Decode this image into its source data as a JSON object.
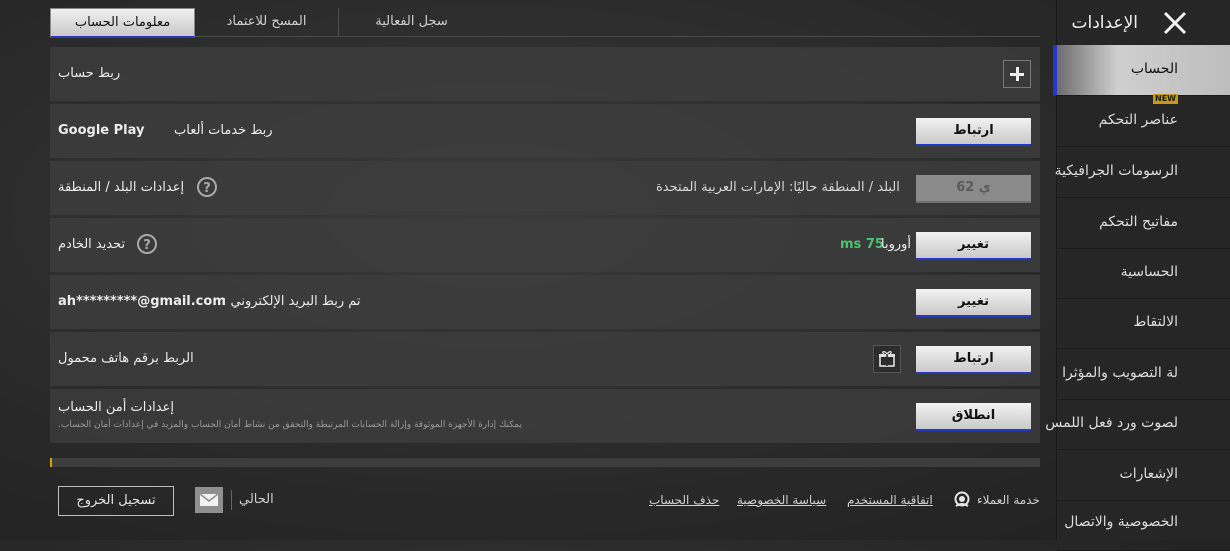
{
  "sidebar": {
    "title": "الإعدادات",
    "items": [
      {
        "label": "الحساب",
        "active": true
      },
      {
        "label": "عناصر التحكم",
        "badge": "NEW"
      },
      {
        "label": "الرسومات الجرافيكية"
      },
      {
        "label": "مفاتيح التحكم"
      },
      {
        "label": "الحساسية"
      },
      {
        "label": "الالتقاط"
      },
      {
        "label": "لة التصويب والمؤثرا"
      },
      {
        "label": "لصوت ورد فعل اللمس"
      },
      {
        "label": "الإشعارات"
      },
      {
        "label": "الخصوصية والاتصال"
      }
    ]
  },
  "tabs": [
    {
      "label": "معلومات الحساب",
      "active": true
    },
    {
      "label": "المسح للاعتماد"
    },
    {
      "label": "سجل الفعالية"
    }
  ],
  "rows": {
    "link_account": {
      "title": "ربط حساب"
    },
    "google_play": {
      "title": "ربط خدمات ألعاب",
      "brand": "Google Play",
      "button": "ارتباط"
    },
    "region": {
      "title": "إعدادات البلد / المنطقة",
      "current": "البلد / المنطقة حاليًا: الإمارات العربية المتحدة",
      "button": "62 ي"
    },
    "server": {
      "title": "تحديد الخادم",
      "region": "أوروبا",
      "ping": "75 ms",
      "button": "تغيير"
    },
    "email": {
      "title": "تم ربط البريد الإلكتروني :",
      "email": "ah*********@gmail.com",
      "button": "تغيير"
    },
    "phone": {
      "title": "الربط برقم هاتف محمول",
      "button": "ارتباط"
    },
    "security": {
      "title": "إعدادات أمن الحساب",
      "desc": "يمكنك إدارة الأجهزة الموثوقة وإزالة الحسابات المرتبطة والتحقق من نشاط أمان الحساب والمزيد في إعدادات أمان الحساب.",
      "button": "انطلاق"
    }
  },
  "progress": {
    "value": 0.002
  },
  "footer": {
    "logout": "تسجيل الخروج",
    "current": "الحالي",
    "support": "خدمة العملاء",
    "links": [
      "اتفاقية المستخدم",
      "سياسة الخصوصية",
      "حذف الحساب"
    ]
  },
  "colors": {
    "accent": "#2636c9",
    "ping": "#4cc46e",
    "progress": "#d8a000"
  }
}
